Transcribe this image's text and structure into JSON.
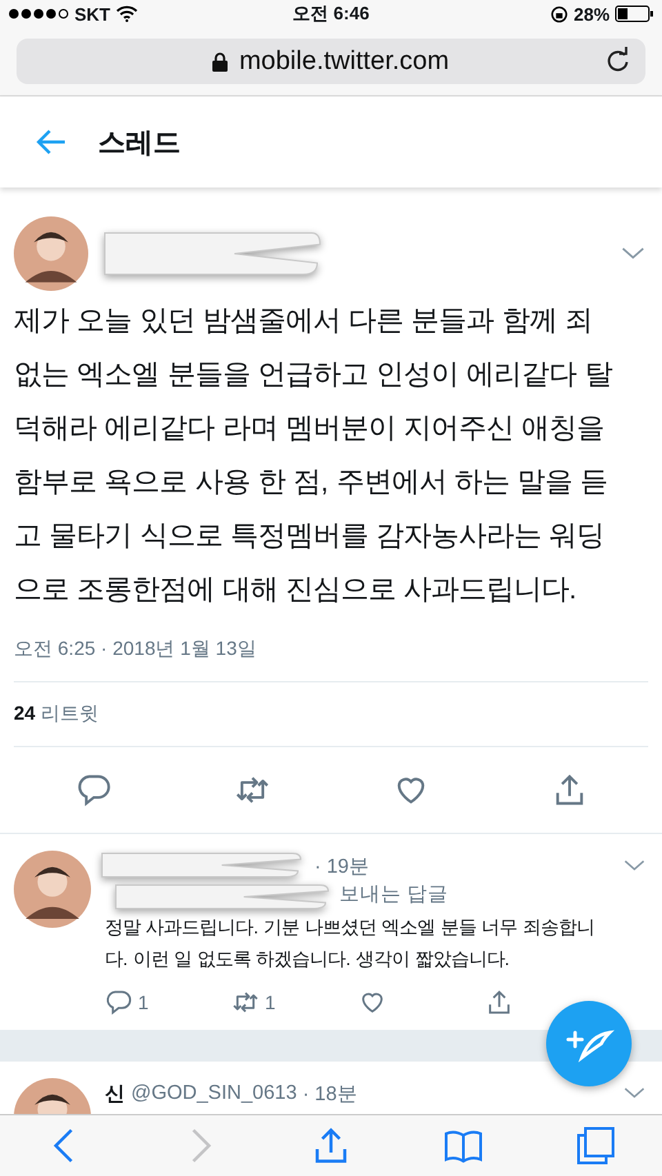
{
  "status_bar": {
    "carrier": "SKT",
    "time": "오전 6:46",
    "battery": "28%"
  },
  "address_bar": {
    "url": "mobile.twitter.com"
  },
  "header": {
    "title": "스레드"
  },
  "main_tweet": {
    "redacted": true,
    "text_lines": [
      "제가 오늘 있던 밤샘줄에서 다른 분들과 함께 죄",
      "없는 엑소엘 분들을 언급하고 인성이 에리같다 탈",
      "덕해라 에리같다 라며 멤버분이 지어주신 애칭을",
      "함부로 욕으로 사용 한 점, 주변에서 하는 말을 듣",
      "고 물타기 식으로 특정멤버를 감자농사라는 워딩",
      "으로 조롱한점에 대해 진심으로 사과드립니다."
    ],
    "timestamp": "오전 6:25 · 2018년 1월 13일",
    "retweet_count": "24",
    "retweet_label": "리트윗",
    "actions": [
      {
        "kind": "reply"
      },
      {
        "kind": "retweet"
      },
      {
        "kind": "like"
      },
      {
        "kind": "share"
      }
    ]
  },
  "replies": [
    {
      "redacted": true,
      "time": "· 19분",
      "reply_to": "보내는 답글",
      "text_lines": [
        "정말 사과드립니다. 기분 나쁘셨던 엑소엘 분들 너무 죄송합니",
        "다. 이런 일 없도록 하겠습니다. 생각이 짧았습니다."
      ],
      "actions": [
        {
          "kind": "reply",
          "count": "1"
        },
        {
          "kind": "retweet",
          "count": "1"
        },
        {
          "kind": "like"
        },
        {
          "kind": "share"
        }
      ]
    },
    {
      "name": "신",
      "handle": "@GOD_SIN_0613",
      "time": "· 18분"
    }
  ],
  "toolbar": [
    {
      "kind": "back",
      "disabled": false
    },
    {
      "kind": "forward",
      "disabled": true
    },
    {
      "kind": "share",
      "disabled": false
    },
    {
      "kind": "bookmarks",
      "disabled": false
    },
    {
      "kind": "tabs",
      "disabled": false
    }
  ]
}
